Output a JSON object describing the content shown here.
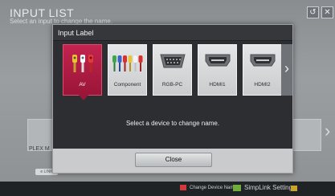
{
  "background": {
    "title": "INPUT LIST",
    "subtitle": "Select an input to change the name.",
    "card_label": "PLEX M",
    "tag_label": "e LINK"
  },
  "dialog": {
    "title": "Input Label",
    "message": "Select a device to change name.",
    "close_label": "Close",
    "more_icon": "›",
    "inputs": [
      {
        "label": "AV",
        "icon": "av-jacks",
        "selected": true
      },
      {
        "label": "Component",
        "icon": "component-jacks",
        "selected": false
      },
      {
        "label": "RGB-PC",
        "icon": "vga-port",
        "selected": false
      },
      {
        "label": "HDMI1",
        "icon": "hdmi-port",
        "selected": false
      },
      {
        "label": "HDMI2",
        "icon": "hdmi-port",
        "selected": false
      }
    ]
  },
  "top_buttons": {
    "back_icon": "↺",
    "exit_icon": "✕"
  },
  "bottom_bar": {
    "change_device_name": "Change Device Name",
    "simplink": "SimpLink Setting",
    "accent_red": "#d03a3a",
    "accent_green": "#6fae3c",
    "accent_yellow": "#c9a52a"
  },
  "colors": {
    "selected_tile": "#b01e46",
    "dialog_bg": "#2c2e31"
  }
}
